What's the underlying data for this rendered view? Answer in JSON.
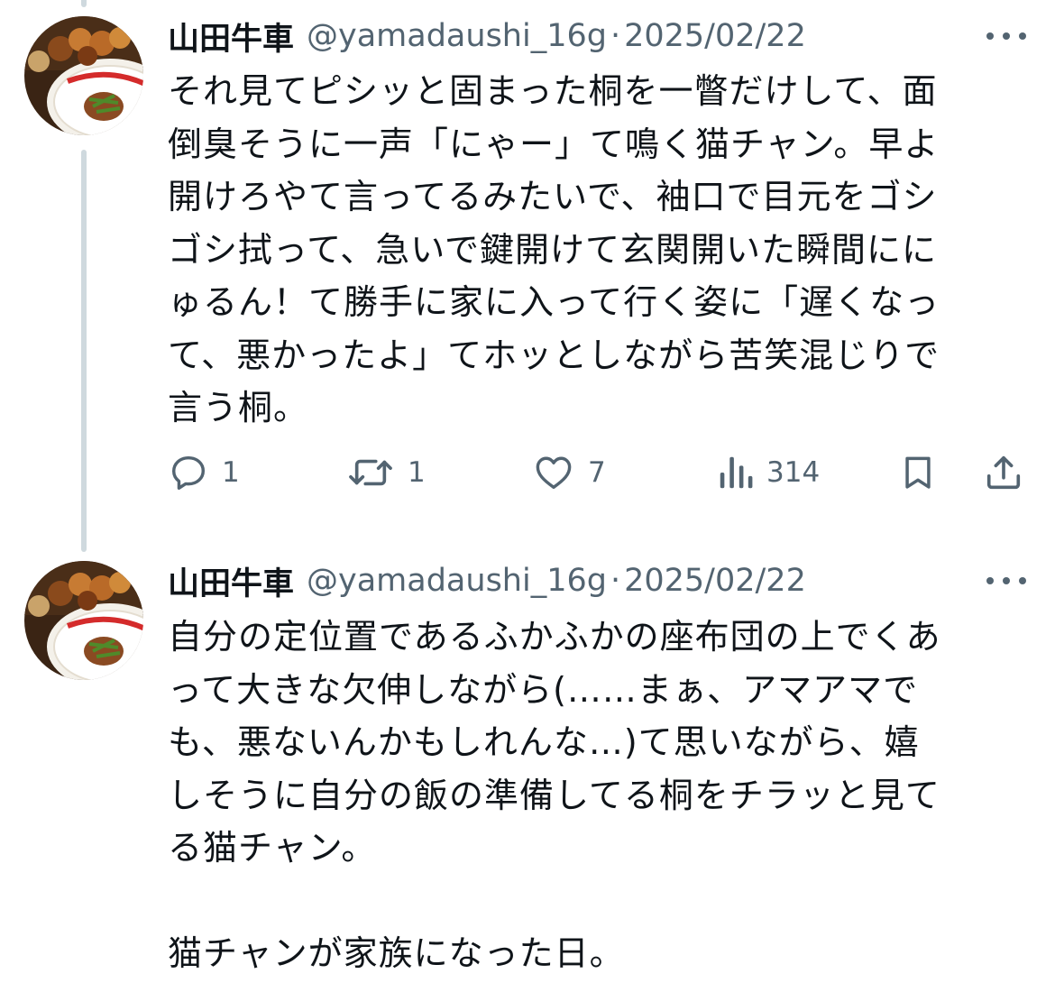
{
  "tweets": [
    {
      "display_name": "山田牛車",
      "handle": "@yamadaushi_16g",
      "separator": "·",
      "date": "2025/02/22",
      "text": "それ見てピシッと固まった桐を一瞥だけして、面\n倒臭そうに一声「にゃー」て鳴く猫チャン。早よ\n開けろやて言ってるみたいで、袖口で目元をゴシ\nゴシ拭って、急いで鍵開けて玄関開いた瞬間にに\nゅるん！て勝手に家に入って行く姿に「遅くなっ\nて、悪かったよ」てホッとしながら苦笑混じりで\n言う桐。",
      "actions": {
        "replies": "1",
        "reposts": "1",
        "likes": "7",
        "views": "314"
      },
      "icons": [
        "reply-icon",
        "repost-icon",
        "like-icon",
        "views-icon",
        "bookmark-icon",
        "share-icon"
      ]
    },
    {
      "display_name": "山田牛車",
      "handle": "@yamadaushi_16g",
      "separator": "·",
      "date": "2025/02/22",
      "text": "自分の定位置であるふかふかの座布団の上でくあ\nって大きな欠伸しながら(……まぁ、アマアマで\nも、悪ないんかもしれんな…)て思いながら、嬉\nしそうに自分の飯の準備してる桐をチラッと見て\nる猫チャン。\n\n猫チャンが家族になった日。"
    }
  ],
  "colors": {
    "text": "#0f1419",
    "secondary": "#536471",
    "thread_line": "#cfd9de"
  }
}
